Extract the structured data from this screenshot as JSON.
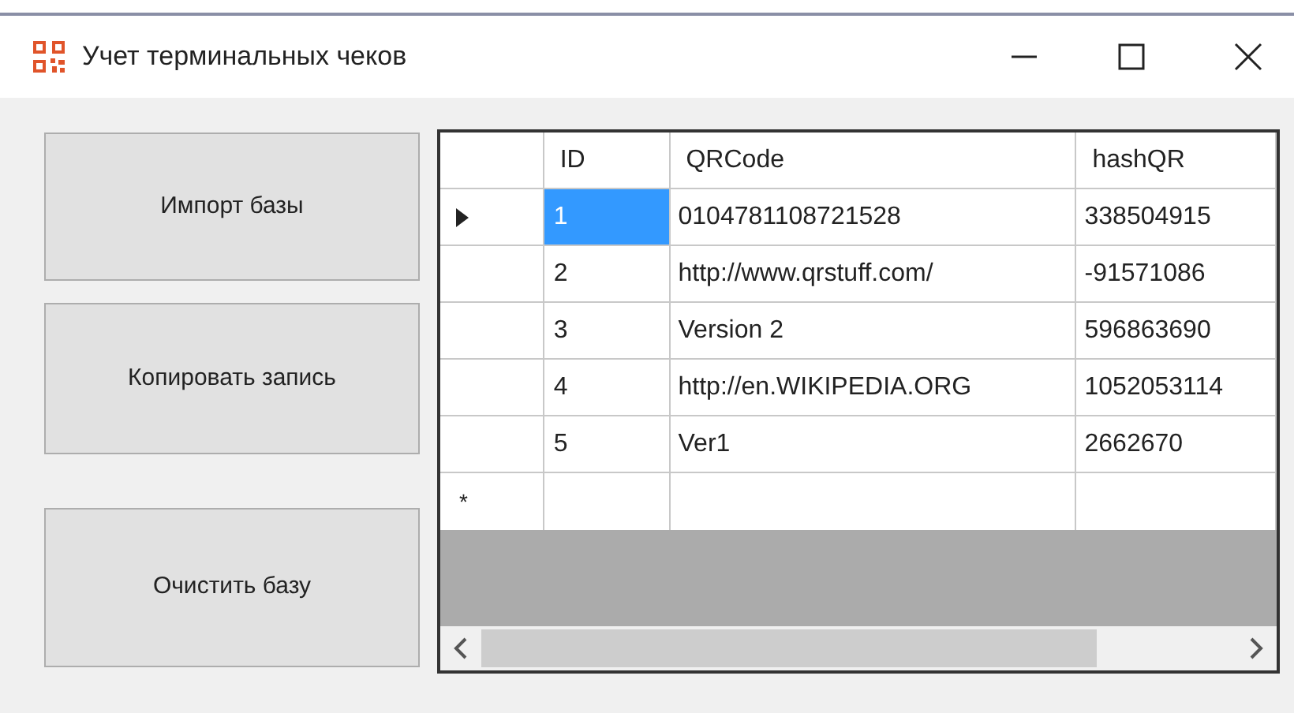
{
  "window": {
    "title": "Учет терминальных чеков"
  },
  "buttons": [
    {
      "label": "Импорт базы"
    },
    {
      "label": "Копировать запись"
    },
    {
      "label": "Очистить базу"
    }
  ],
  "table": {
    "columns": [
      "ID",
      "QRCode",
      "hashQR"
    ],
    "rows": [
      {
        "selected": true,
        "cells": [
          "1",
          "0104781108721528",
          "338504915"
        ]
      },
      {
        "selected": false,
        "cells": [
          "2",
          "http://www.qrstuff.com/",
          "-91571086"
        ]
      },
      {
        "selected": false,
        "cells": [
          "3",
          "Version 2",
          "596863690"
        ]
      },
      {
        "selected": false,
        "cells": [
          "4",
          "http://en.WIKIPEDIA.ORG",
          "1052053114"
        ]
      },
      {
        "selected": false,
        "cells": [
          "5",
          "Ver1",
          "2662670"
        ]
      }
    ],
    "new_row_marker": "*"
  }
}
